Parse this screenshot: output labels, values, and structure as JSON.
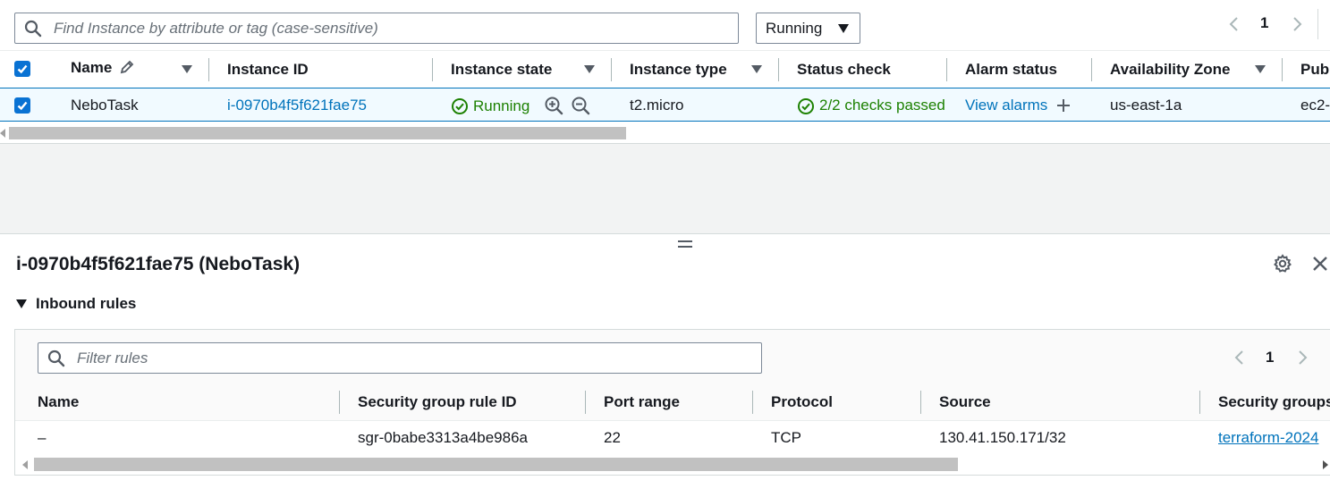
{
  "top": {
    "search_placeholder": "Find Instance by attribute or tag (case-sensitive)",
    "filter_value": "Running",
    "page": "1"
  },
  "instances_table": {
    "headers": {
      "name": "Name",
      "instance_id": "Instance ID",
      "instance_state": "Instance state",
      "instance_type": "Instance type",
      "status_check": "Status check",
      "alarm_status": "Alarm status",
      "availability_zone": "Availability Zone",
      "public": "Publ"
    },
    "row": {
      "name": "NeboTask",
      "instance_id": "i-0970b4f5f621fae75",
      "instance_state": "Running",
      "instance_type": "t2.micro",
      "status_check": "2/2 checks passed",
      "alarm_status": "View alarms",
      "availability_zone": "us-east-1a",
      "public": "ec2-"
    },
    "scroll_position": 0.47
  },
  "details": {
    "title": "i-0970b4f5f621fae75 (NeboTask)",
    "section_title": "Inbound rules",
    "filter_placeholder": "Filter rules",
    "page": "1",
    "headers": {
      "name": "Name",
      "rule_id": "Security group rule ID",
      "port_range": "Port range",
      "protocol": "Protocol",
      "source": "Source",
      "security_groups": "Security groups"
    },
    "rows": [
      {
        "name": "–",
        "rule_id": "sgr-0babe3313a4be986a",
        "port_range": "22",
        "protocol": "TCP",
        "source": "130.41.150.171/32",
        "security_groups": "terraform-2024"
      }
    ],
    "scroll_position": 0.7
  },
  "colors": {
    "accent": "#0972d3",
    "link": "#0073bb",
    "success": "#1d8102",
    "selected_row_bg": "#f1faff",
    "selected_row_border": "#0073bb",
    "panel_bg": "#f2f3f3"
  }
}
